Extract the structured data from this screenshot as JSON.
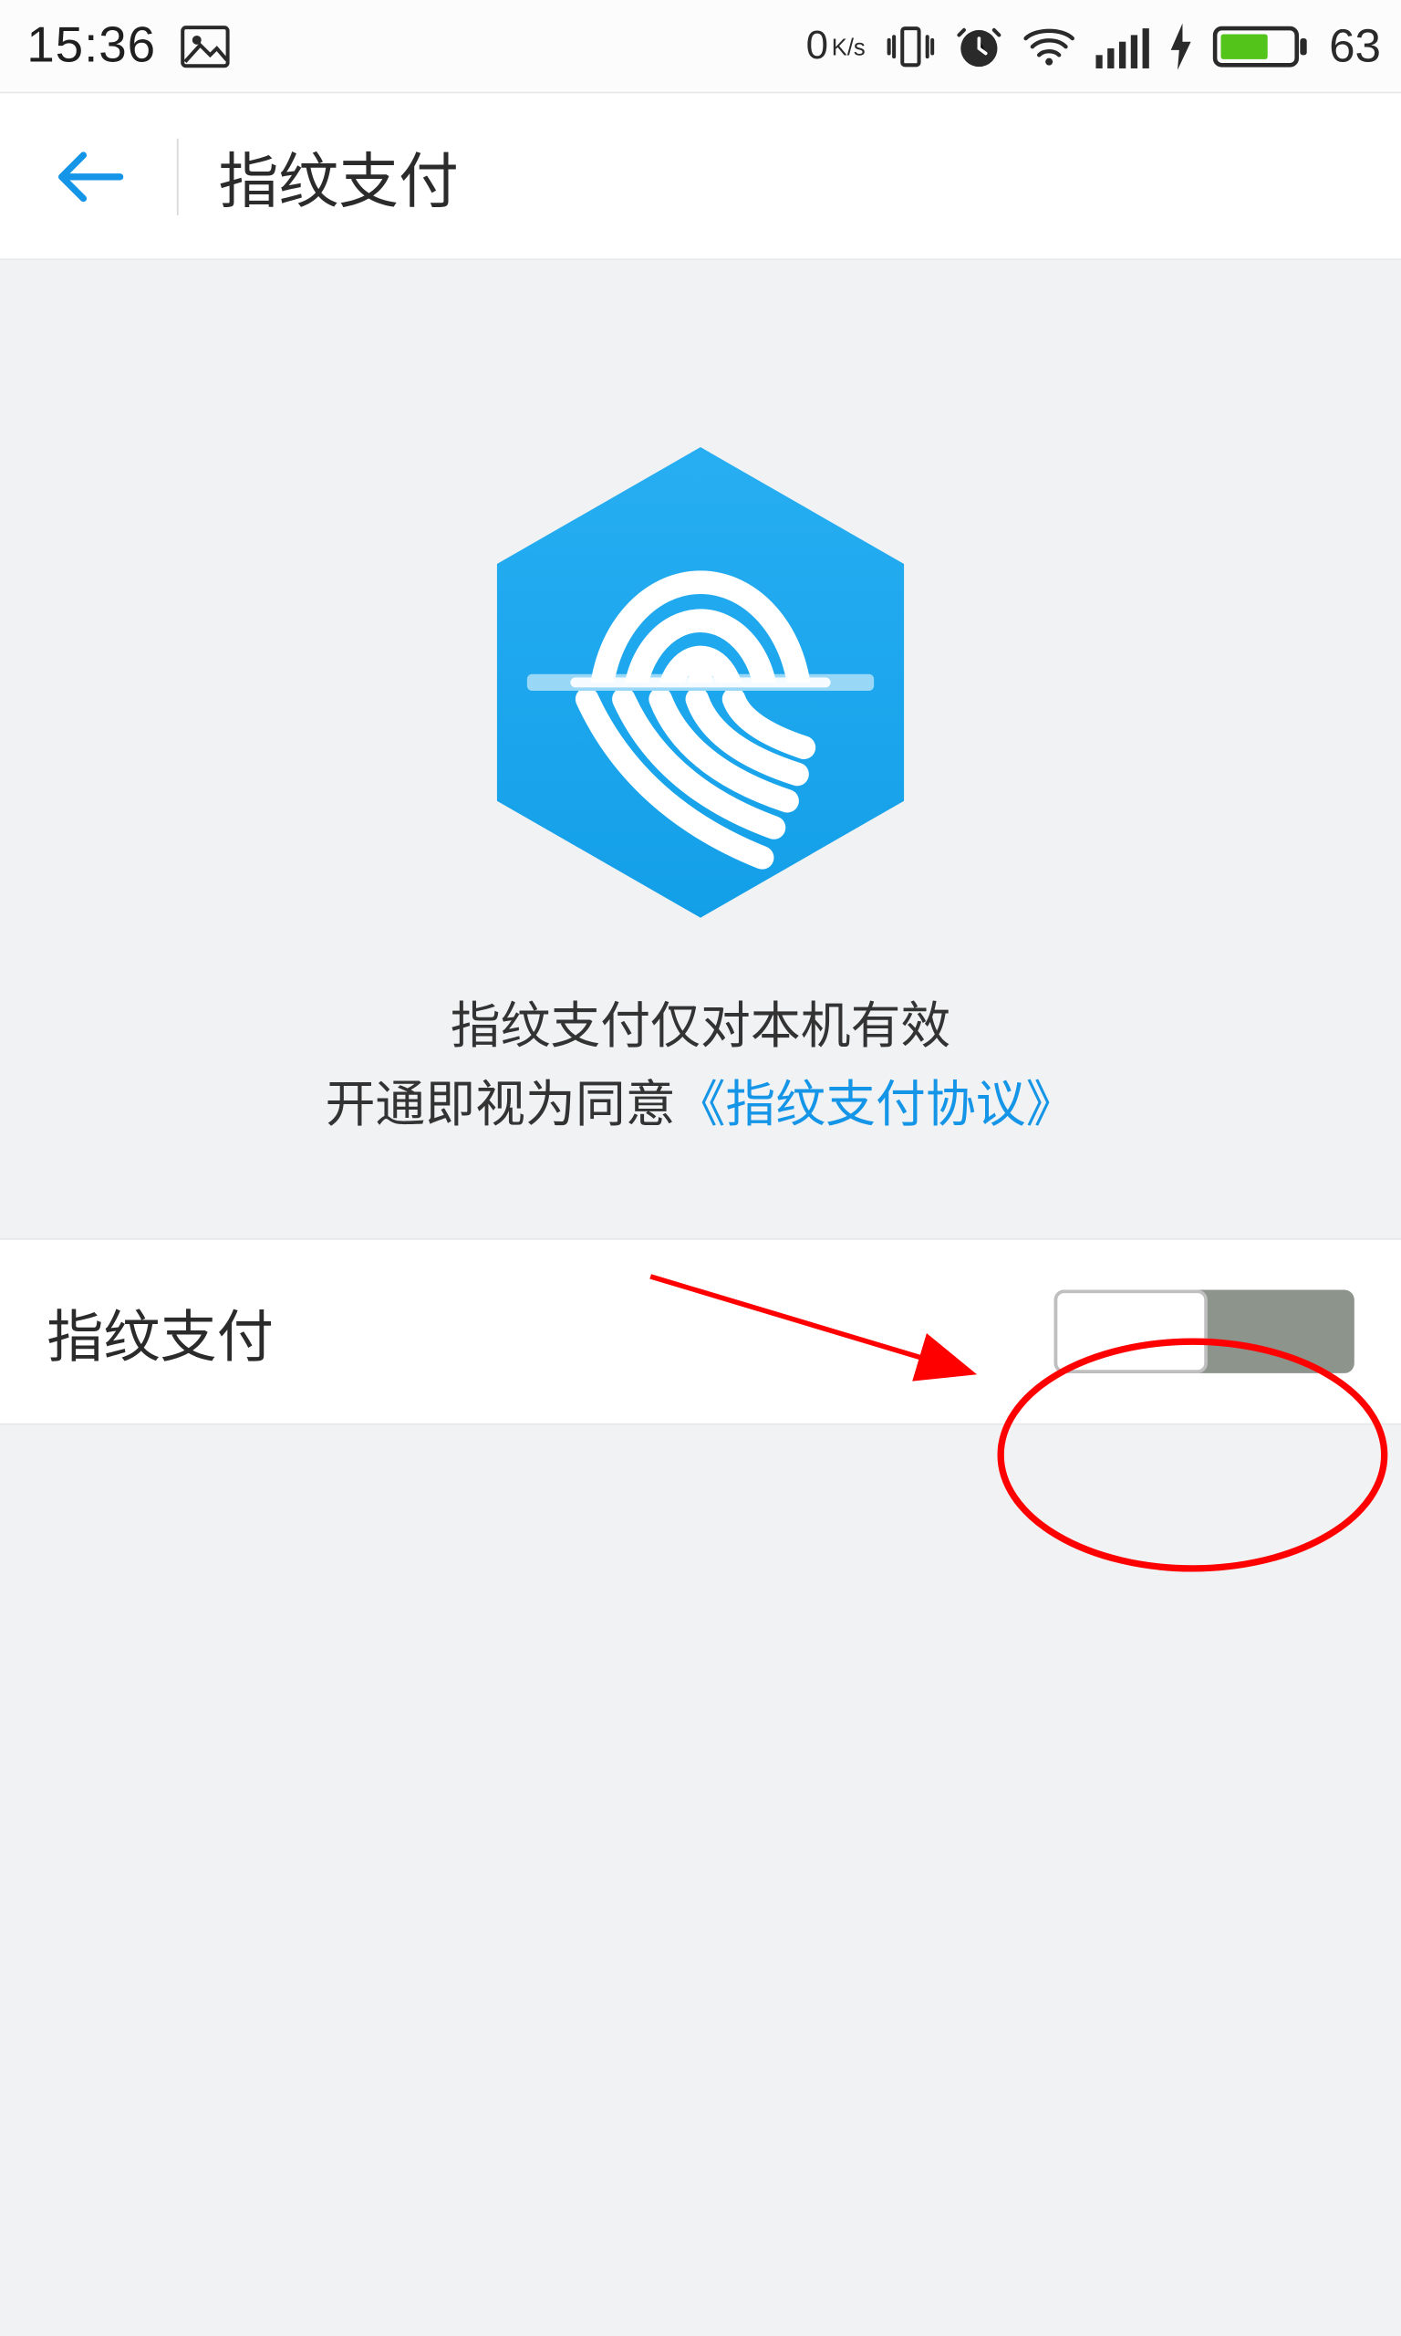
{
  "status": {
    "time": "15:36",
    "net_speed_value": "0",
    "net_speed_unit": "K/s",
    "battery_percent": "63"
  },
  "header": {
    "title": "指纹支付"
  },
  "hero": {
    "line1": "指纹支付仅对本机有效",
    "line2_prefix": "开通即视为同意",
    "agreement_text": "《指纹支付协议》"
  },
  "setting": {
    "label": "指纹支付",
    "enabled": false
  }
}
